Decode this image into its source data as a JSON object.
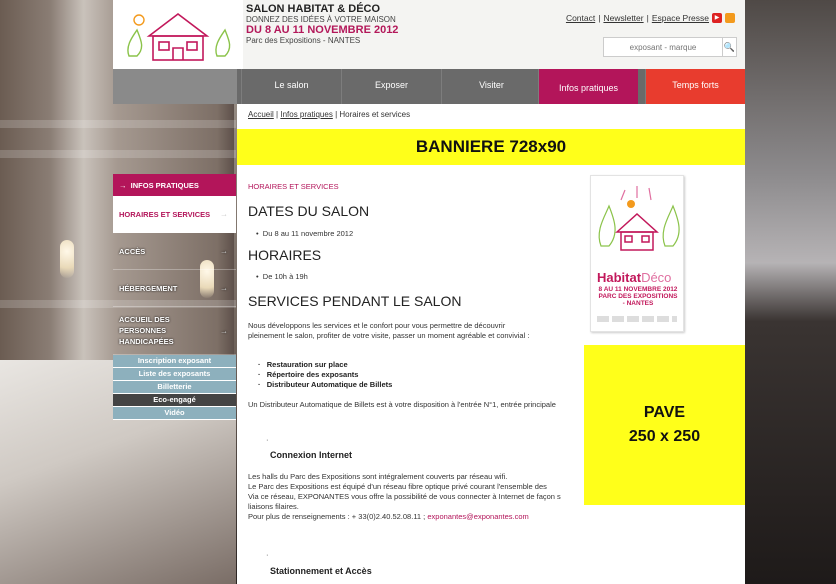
{
  "header": {
    "line1": "SALON HABITAT & DÉCO",
    "line2": "DONNEZ DES IDÉES À VOTRE MAISON",
    "line3": "DU 8 AU 11 NOVEMBRE 2012",
    "line4": "Parc des Expositions - NANTES",
    "links": [
      "Contact",
      "Newsletter",
      "Espace Presse"
    ],
    "search_placeholder": "exposant - marque"
  },
  "nav": [
    "Le salon",
    "Exposer",
    "Visiter",
    "Infos pratiques",
    "Temps forts"
  ],
  "breadcrumb": [
    "Accueil",
    "Infos pratiques",
    "Horaires et services"
  ],
  "banner": "BANNIERE 728x90",
  "pave": [
    "PAVE",
    "250 x 250"
  ],
  "sidebar": {
    "head": "INFOS PRATIQUES",
    "items": [
      "HORAIRES ET SERVICES",
      "ACCÈS",
      "HÉBERGEMENT",
      "ACCUEIL DES PERSONNES HANDICAPÉES"
    ],
    "subs": [
      "Inscription exposant",
      "Liste des exposants",
      "Billetterie",
      "Eco-engagé",
      "Vidéo"
    ]
  },
  "poster": {
    "title_a": "Habitat",
    "title_b": "Déco",
    "dates": "8 AU 11 NOVEMBRE 2012",
    "place": "PARC DES EXPOSITIONS - NANTES"
  },
  "main": {
    "kicker": "HORAIRES ET SERVICES",
    "h_dates": "DATES DU SALON",
    "dates": "Du 8 au 11 novembre 2012",
    "h_horaires": "HORAIRES",
    "horaires": "De 10h à 19h",
    "h_services": "SERVICES PENDANT LE SALON",
    "intro": "Nous développons les services et le confort pour vous permettre de découvrir pleinement le salon, profiter de votre visite, passer un moment agréable et convivial :",
    "services": [
      "Restauration sur place",
      "Répertoire des exposants",
      "Distributeur Automatique de Billets"
    ],
    "dab": "Un Distributeur Automatique de Billets est à votre disposition à l'entrée N°1, entrée principale",
    "h_internet": "Connexion Internet",
    "internet1": "Les halls du Parc des Expositions sont intégralement couverts par réseau wifi.",
    "internet2": "Le Parc des Expositions est équipé d'un réseau fibre optique privé courant l'ensemble des",
    "internet3": "Via ce réseau, EXPONANTES vous offre la possibilité de vous connecter à Internet de façon s",
    "internet4": "liaisons filaires.",
    "contact_prefix": "Pour plus de renseignements : + 33(0)2.40.52.08.11 ;",
    "contact_email": "exponantes@exponantes.com",
    "h_stationnement": "Stationnement et Accès"
  }
}
